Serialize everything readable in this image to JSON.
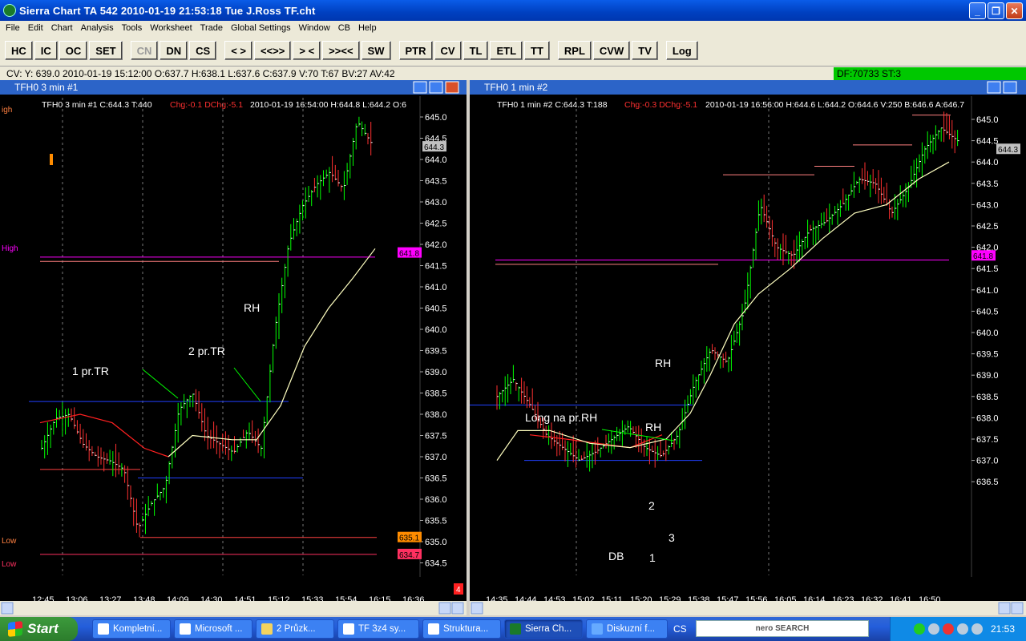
{
  "window": {
    "title": "Sierra Chart TA 542  2010-01-19  21:53:18  Tue   J.Ross TF.cht",
    "min": "_",
    "max": "❐",
    "close": "✕"
  },
  "menu": [
    "File",
    "Edit",
    "Chart",
    "Analysis",
    "Tools",
    "Worksheet",
    "Trade",
    "Global Settings",
    "Window",
    "CB",
    "Help"
  ],
  "toolbar": [
    "HC",
    "IC",
    "OC",
    "SET",
    "CN",
    "DN",
    "CS",
    "< >",
    "<<>>",
    "> <",
    ">><<",
    "SW",
    "PTR",
    "CV",
    "TL",
    "ETL",
    "TT",
    "RPL",
    "CVW",
    "TV",
    "Log"
  ],
  "status": {
    "cv": "CV: Y: 639.0  2010-01-19  15:12:00  O:637.7  H:638.1  L:637.6  C:637.9  V:70  T:67  BV:27  AV:42",
    "df": "DF:70733  ST:3"
  },
  "chart1": {
    "window_title": "TFH0  3 min  #1",
    "header": {
      "sym": "TFH0  3 min   #1  C:644.3  T:440",
      "chg": "Chg:-0.1  DChg:-5.1",
      "tail": "2010-01-19  16:54:00  H:644.8  L:644.2  O:6"
    },
    "labels": [
      "1 pr.TR",
      "2 pr.TR",
      "RH"
    ],
    "side_labels": [
      "High",
      "Low",
      "Low"
    ],
    "price_tags": [
      "644.3",
      "641.8",
      "635.1",
      "634.7"
    ],
    "page_badge": "4",
    "prices": [
      "645.0",
      "644.5",
      "644.0",
      "643.5",
      "643.0",
      "642.5",
      "642.0",
      "641.5",
      "641.0",
      "640.5",
      "640.0",
      "639.5",
      "639.0",
      "638.5",
      "638.0",
      "637.5",
      "637.0",
      "636.5",
      "636.0",
      "635.5",
      "635.0",
      "634.5"
    ],
    "times": [
      "12:45",
      "13:06",
      "13:27",
      "13:48",
      "14:09",
      "14:30",
      "14:51",
      "15:12",
      "15:33",
      "15:54",
      "16:15",
      "16:36"
    ]
  },
  "chart2": {
    "window_title": "TFH0  1 min   #2",
    "header": {
      "sym": "TFH0  1 min   #2  C:644.3  T:188",
      "chg": "Chg:-0.3  DChg:-5.1",
      "tail": "2010-01-19  16:56:00  H:644.6  L:644.2  O:644.6  V:250  B:646.6  A:646.7"
    },
    "labels": [
      "RH",
      "Long na pr.RH",
      "RH",
      "2",
      "3",
      "DB",
      "1"
    ],
    "price_tags": [
      "644.3",
      "641.8"
    ],
    "prices": [
      "645.0",
      "644.5",
      "644.0",
      "643.5",
      "643.0",
      "642.5",
      "642.0",
      "641.5",
      "641.0",
      "640.5",
      "640.0",
      "639.5",
      "639.0",
      "638.5",
      "638.0",
      "637.5",
      "637.0",
      "636.5"
    ],
    "times": [
      "14:35",
      "14:44",
      "14:53",
      "15:02",
      "15:11",
      "15:20",
      "15:29",
      "15:38",
      "15:47",
      "15:56",
      "16:05",
      "16:14",
      "16:23",
      "16:32",
      "16:41",
      "16:50"
    ]
  },
  "taskbar": {
    "start": "Start",
    "tasks": [
      "Kompletní...",
      "Microsoft ...",
      "2 Průzk...",
      "TF 3z4 sy...",
      "Struktura...",
      "Sierra Ch...",
      "Diskuzní f..."
    ],
    "lang": "CS",
    "search": "nero SEARCH",
    "clock": "21:53"
  },
  "colors": {
    "bull": "#00ff00",
    "bear": "#ff3030",
    "ma_red": "#ff2020",
    "ma_white": "#ffffc0",
    "magenta": "#ff00ff",
    "blue": "#2040ff"
  }
}
